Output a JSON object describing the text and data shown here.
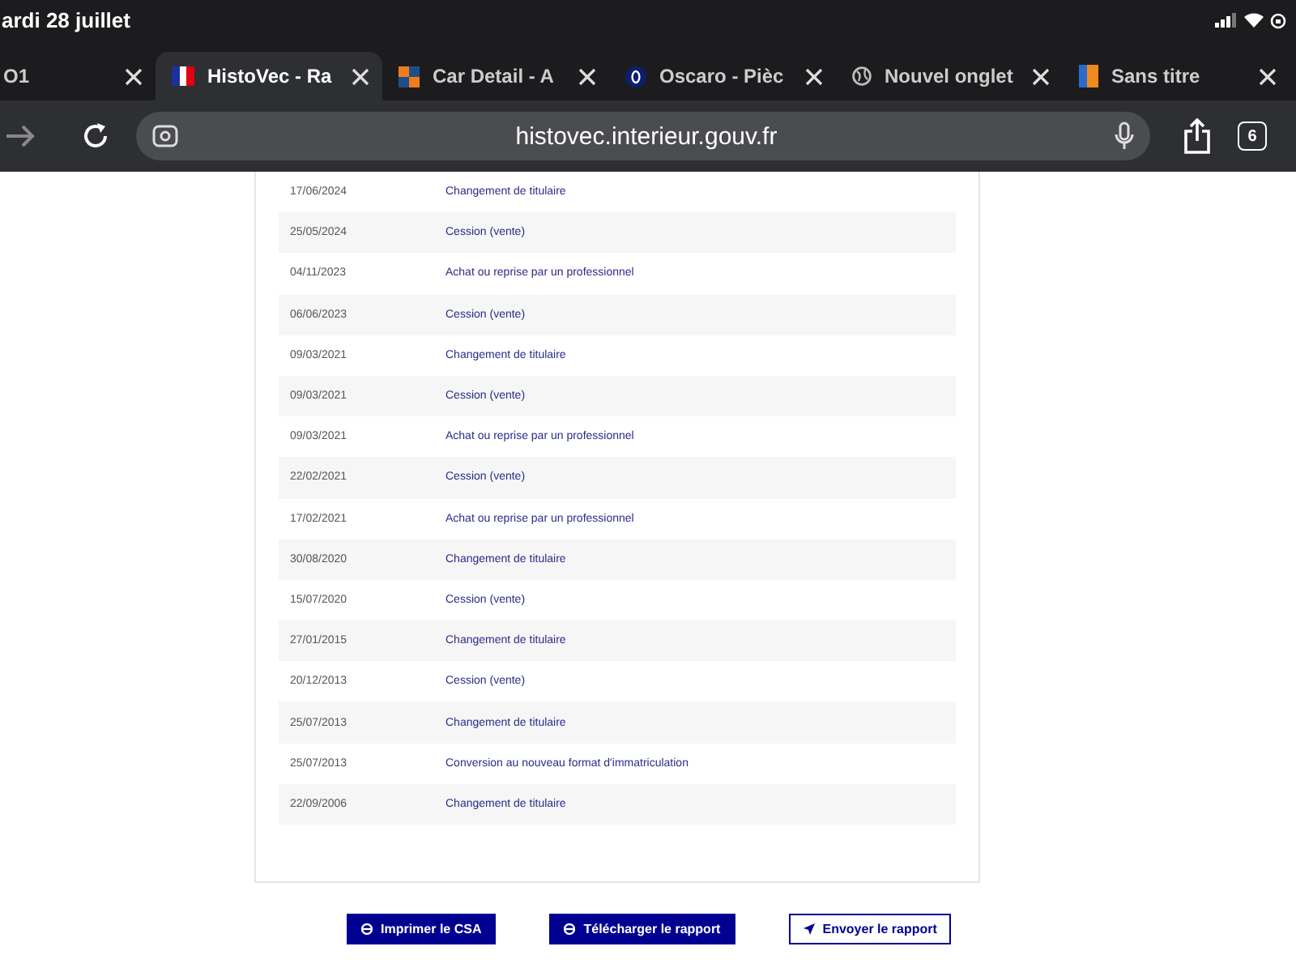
{
  "status_bar": {
    "date": "ardi 28 juillet"
  },
  "tabs": [
    {
      "title": "O1",
      "selected": false,
      "kind": "none"
    },
    {
      "title": "HistoVec - Ra",
      "selected": true,
      "kind": "flag"
    },
    {
      "title": "Car Detail - A",
      "selected": false,
      "kind": "squares"
    },
    {
      "title": "Oscaro - Pièc",
      "selected": false,
      "kind": "disc"
    },
    {
      "title": "Nouvel onglet",
      "selected": false,
      "kind": "globe"
    },
    {
      "title": "Sans titre",
      "selected": false,
      "kind": "bar"
    }
  ],
  "address_bar": {
    "url": "histovec.interieur.gouv.fr",
    "tab_count": "6"
  },
  "history": [
    {
      "date": "17/06/2024",
      "event": "Changement de titulaire"
    },
    {
      "date": "25/05/2024",
      "event": "Cession (vente)"
    },
    {
      "date": "04/11/2023",
      "event": "Achat ou reprise par un professionnel"
    },
    {
      "date": "06/06/2023",
      "event": "Cession (vente)"
    },
    {
      "date": "09/03/2021",
      "event": "Changement de titulaire"
    },
    {
      "date": "09/03/2021",
      "event": "Cession (vente)"
    },
    {
      "date": "09/03/2021",
      "event": "Achat ou reprise par un professionnel"
    },
    {
      "date": "22/02/2021",
      "event": "Cession (vente)"
    },
    {
      "date": "17/02/2021",
      "event": "Achat ou reprise par un professionnel"
    },
    {
      "date": "30/08/2020",
      "event": "Changement de titulaire"
    },
    {
      "date": "15/07/2020",
      "event": "Cession (vente)"
    },
    {
      "date": "27/01/2015",
      "event": "Changement de titulaire"
    },
    {
      "date": "20/12/2013",
      "event": "Cession (vente)"
    },
    {
      "date": "25/07/2013",
      "event": "Changement de titulaire"
    },
    {
      "date": "25/07/2013",
      "event": "Conversion au nouveau format d'immatriculation"
    },
    {
      "date": "22/09/2006",
      "event": "Changement de titulaire"
    }
  ],
  "buttons": [
    {
      "label": "Imprimer le CSA",
      "kind": "primary"
    },
    {
      "label": "Télécharger le rapport",
      "kind": "primary"
    },
    {
      "label": "Envoyer le rapport",
      "kind": "secondary"
    }
  ]
}
